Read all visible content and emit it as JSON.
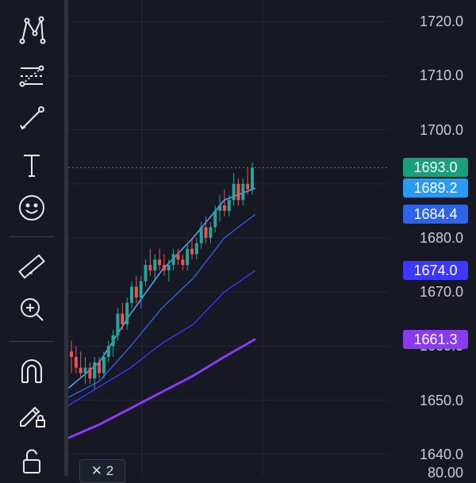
{
  "colors": {
    "background": "#161824",
    "grid": "#232636",
    "up_candle": "#26a69a",
    "down_candle": "#ef5350",
    "ma_fast": "#4fa3f7",
    "ma_mid": "#2f63e8",
    "ma_slow": "#3d38ff",
    "ma_long": "#8a3bf0",
    "last_price": "#17a07a"
  },
  "toolbar": {
    "tools": [
      {
        "name": "pattern-tool-icon"
      },
      {
        "name": "fib-retracement-icon"
      },
      {
        "name": "trend-line-icon"
      },
      {
        "name": "text-tool-icon"
      },
      {
        "name": "emoji-icon"
      },
      {
        "name": "ruler-icon"
      },
      {
        "name": "zoom-in-icon"
      },
      {
        "name": "magnet-icon"
      },
      {
        "name": "lock-drawing-icon"
      },
      {
        "name": "unlock-icon"
      }
    ]
  },
  "price_axis": {
    "ticks": [
      "1720.0",
      "1710.0",
      "1700.0",
      "1690.0",
      "1680.0",
      "1670.0",
      "1660.0",
      "1650.0",
      "1640.0"
    ],
    "sub_value": "80.00"
  },
  "price_badges": [
    {
      "label": "1693.0",
      "color": "#17a07a"
    },
    {
      "label": "1689.2",
      "color": "#2b9af3"
    },
    {
      "label": "1684.4",
      "color": "#2f63e8"
    },
    {
      "label": "1674.0",
      "color": "#3d38ff"
    },
    {
      "label": "1661.3",
      "color": "#8a3bf0"
    }
  ],
  "legend": {
    "label": "✕ 2"
  },
  "chart_data": {
    "type": "line",
    "price_range": [
      1636,
      1724
    ],
    "last_price": 1693.0,
    "series": [
      {
        "name": "",
        "values": [
          1652.2,
          1657.0,
          1666.0,
          1674.0,
          1680.0,
          1687.0,
          1689.2
        ]
      },
      {
        "name": "",
        "values": [
          1650.5,
          1653.5,
          1660.0,
          1667.0,
          1672.5,
          1680.0,
          1684.4
        ]
      },
      {
        "name": "",
        "values": [
          1649.0,
          1652.5,
          1656.0,
          1660.5,
          1664.0,
          1670.0,
          1674.0
        ]
      },
      {
        "name": "",
        "values": [
          1643.0,
          1645.5,
          1648.5,
          1651.5,
          1654.5,
          1658.0,
          1661.3
        ]
      }
    ],
    "candles": [
      [
        1659,
        1661,
        1655,
        1658
      ],
      [
        1658,
        1660,
        1655,
        1656
      ],
      [
        1656,
        1659,
        1654,
        1655
      ],
      [
        1655,
        1658,
        1653,
        1656
      ],
      [
        1656,
        1657,
        1653,
        1654
      ],
      [
        1654,
        1658,
        1652,
        1657
      ],
      [
        1657,
        1658,
        1654,
        1655
      ],
      [
        1655,
        1659,
        1654,
        1658
      ],
      [
        1658,
        1661,
        1657,
        1660
      ],
      [
        1660,
        1663,
        1658,
        1662
      ],
      [
        1662,
        1667,
        1661,
        1666
      ],
      [
        1666,
        1668,
        1663,
        1664
      ],
      [
        1664,
        1669,
        1663,
        1668
      ],
      [
        1668,
        1672,
        1667,
        1671
      ],
      [
        1671,
        1673,
        1668,
        1669
      ],
      [
        1669,
        1673,
        1667,
        1672
      ],
      [
        1672,
        1676,
        1671,
        1675
      ],
      [
        1675,
        1678,
        1673,
        1674
      ],
      [
        1674,
        1677,
        1672,
        1676
      ],
      [
        1676,
        1678,
        1674,
        1675
      ],
      [
        1675,
        1677,
        1673,
        1674
      ],
      [
        1674,
        1676,
        1672,
        1675
      ],
      [
        1675,
        1678,
        1674,
        1677
      ],
      [
        1677,
        1678,
        1675,
        1676
      ],
      [
        1676,
        1677,
        1674,
        1675
      ],
      [
        1675,
        1679,
        1674,
        1678
      ],
      [
        1678,
        1680,
        1676,
        1677
      ],
      [
        1677,
        1680,
        1676,
        1679
      ],
      [
        1679,
        1683,
        1678,
        1682
      ],
      [
        1682,
        1684,
        1679,
        1680
      ],
      [
        1680,
        1683,
        1679,
        1682
      ],
      [
        1682,
        1686,
        1681,
        1685
      ],
      [
        1685,
        1688,
        1683,
        1686
      ],
      [
        1686,
        1689,
        1684,
        1685
      ],
      [
        1685,
        1688,
        1684,
        1687
      ],
      [
        1687,
        1692,
        1686,
        1690
      ],
      [
        1690,
        1691,
        1686,
        1687
      ],
      [
        1687,
        1691,
        1686,
        1690
      ],
      [
        1690,
        1693,
        1688,
        1689
      ],
      [
        1689,
        1694,
        1688,
        1693
      ]
    ]
  }
}
